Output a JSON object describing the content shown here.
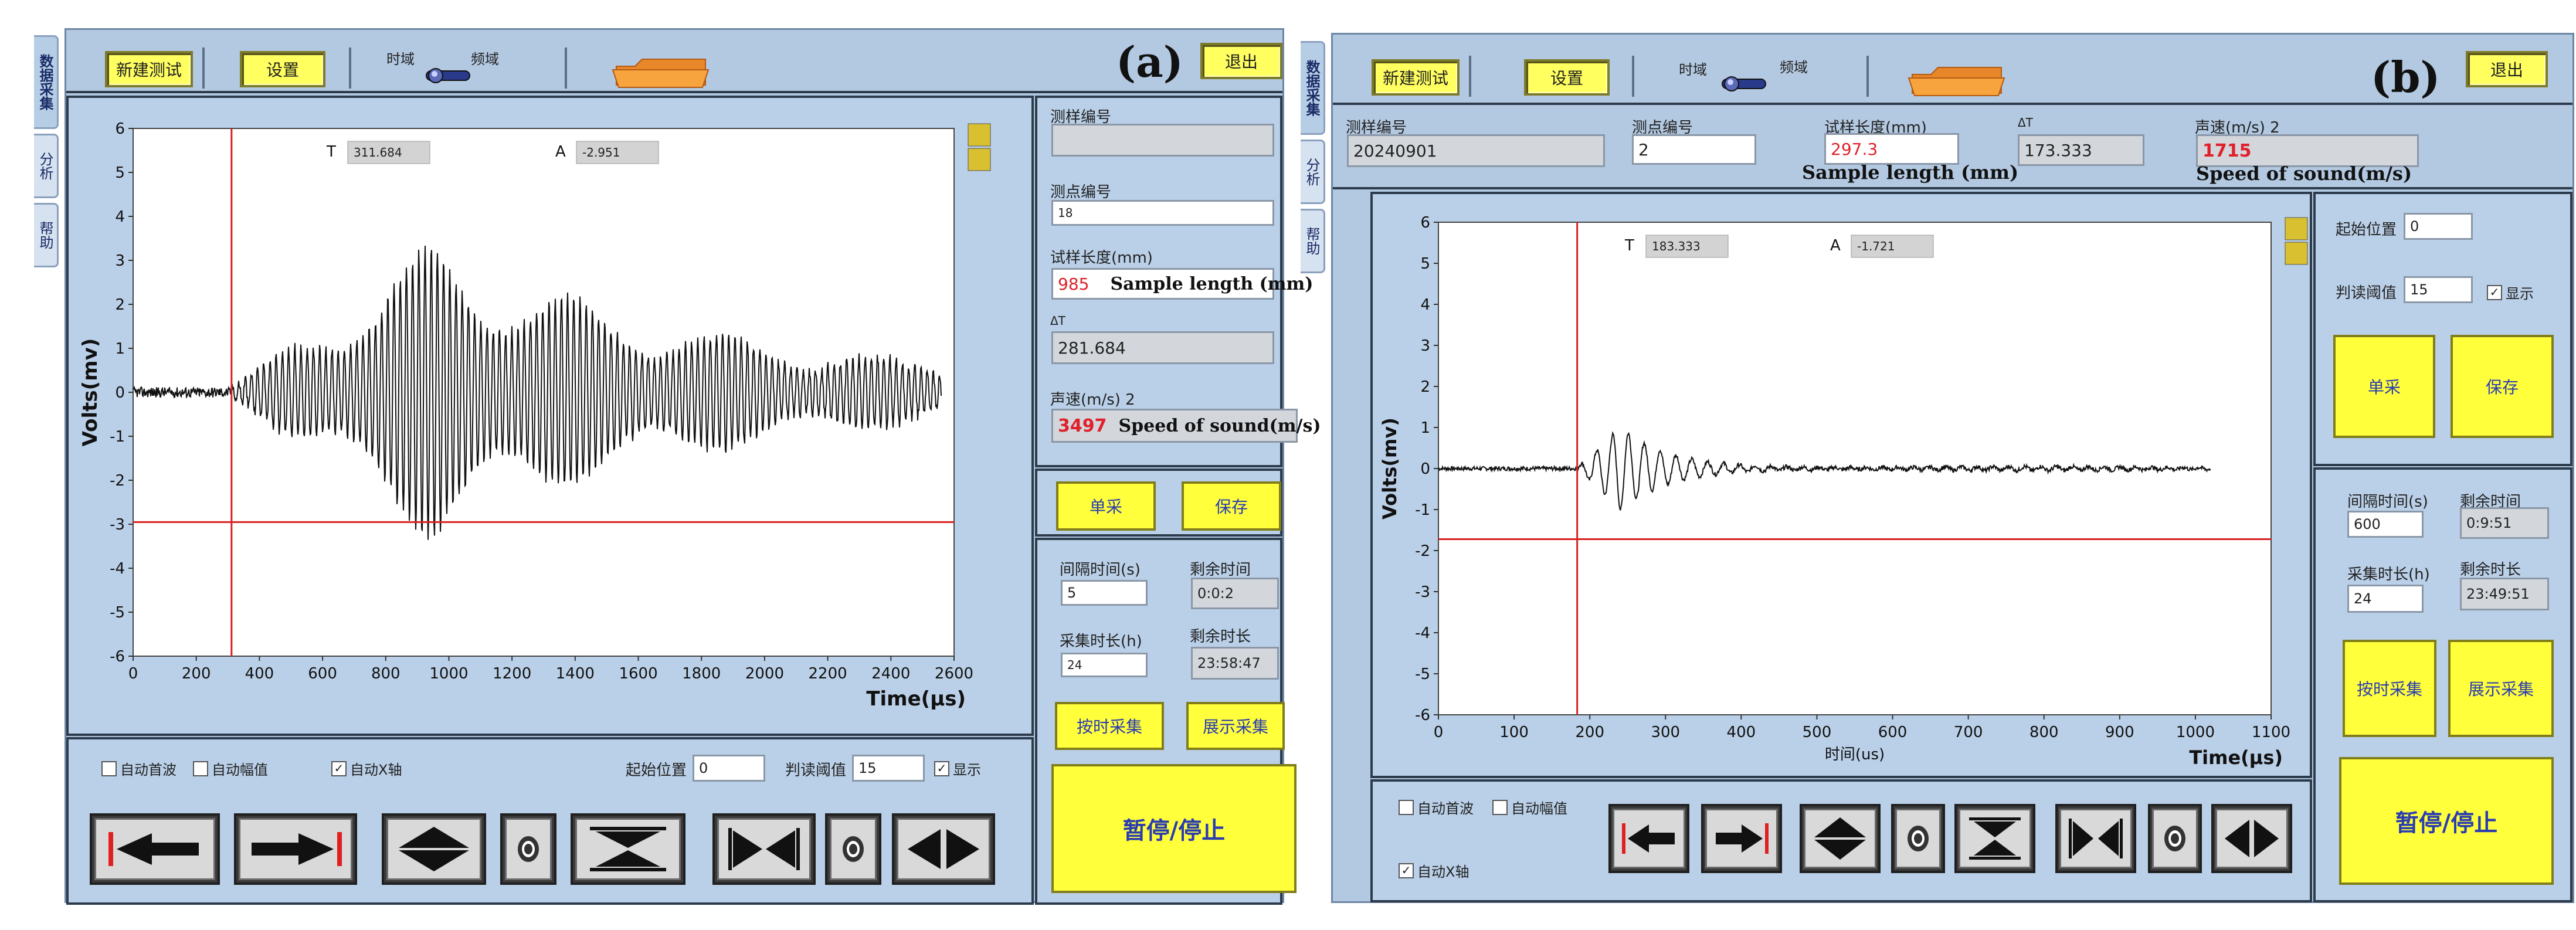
{
  "sidebar": {
    "tabs": [
      "数据采集",
      "分析",
      "帮助"
    ]
  },
  "toolbar": {
    "new_test": "新建测试",
    "settings": "设置",
    "time_domain": "时域",
    "freq_domain": "频域",
    "exit": "退出"
  },
  "fields": {
    "sample_no": "测样编号",
    "point_no": "测点编号",
    "sample_length": "试样长度(mm)",
    "delta_t": "ΔT",
    "sound_speed": "声速(m/s) 2",
    "sample_length_en": "Sample length (mm)",
    "speed_en": "Speed of sound(m/s)"
  },
  "buttons": {
    "single": "单采",
    "save": "保存",
    "timed": "按时采集",
    "show": "展示采集",
    "pause": "暂停/停止"
  },
  "timing": {
    "interval": "间隔时间(s)",
    "remaining": "剩余时间",
    "duration": "采集时长(h)",
    "remaining_duration": "剩余时长"
  },
  "options": {
    "auto_first_wave": "自动首波",
    "auto_amplitude": "自动幅值",
    "auto_x": "自动X轴",
    "start_pos": "起始位置",
    "threshold": "判读阈值",
    "show": "显示"
  },
  "panel_a": {
    "letter": "(a)",
    "sample_no": "",
    "point_no": "18",
    "length": "985",
    "delta_t": "281.684",
    "speed": "3497",
    "interval": "5",
    "remaining": "0:0:2",
    "duration": "24",
    "remaining_duration": "23:58:47",
    "start_pos": "0",
    "threshold": "15",
    "cursor_T": "311.684",
    "cursor_A": "-2.951"
  },
  "panel_b": {
    "letter": "(b)",
    "sample_no": "20240901",
    "point_no": "2",
    "length": "297.3",
    "delta_t": "173.333",
    "speed": "1715",
    "interval": "600",
    "remaining": "0:9:51",
    "duration": "24",
    "remaining_duration": "23:49:51",
    "start_pos": "0",
    "threshold": "15",
    "cursor_T": "183.333",
    "cursor_A": "-1.721"
  },
  "chart_data": [
    {
      "type": "line",
      "title": "",
      "xlabel": "Time(μs)",
      "ylabel": "Volts(mv)",
      "xlim": [
        0,
        2600
      ],
      "ylim": [
        -6,
        6
      ],
      "xticks": [
        0,
        200,
        400,
        600,
        800,
        1000,
        1200,
        1400,
        1600,
        1800,
        2000,
        2200,
        2400,
        2600
      ],
      "yticks": [
        6,
        5,
        4,
        3,
        2,
        1,
        0,
        -1,
        -2,
        -3,
        -4,
        -5,
        -6
      ],
      "cursor": {
        "x": 311.684,
        "y": -2.951
      },
      "signal": {
        "end": 2560,
        "onset": 311,
        "peak_time": 950,
        "peak_amp": 3.3,
        "noise": 0.12
      }
    },
    {
      "type": "line",
      "title": "",
      "xlabel": "时间(us)",
      "xlabel_right": "Time(μs)",
      "ylabel": "Volts(mv)",
      "xlim": [
        0,
        1100
      ],
      "ylim": [
        -6,
        6
      ],
      "xticks": [
        0,
        100,
        200,
        300,
        400,
        500,
        600,
        700,
        800,
        900,
        1000,
        1100
      ],
      "yticks": [
        6,
        5,
        4,
        3,
        2,
        1,
        0,
        -1,
        -2,
        -3,
        -4,
        -5,
        -6
      ],
      "cursor": {
        "x": 183.333,
        "y": -1.721
      },
      "signal": {
        "end": 1020,
        "onset": 183,
        "peak_time": 240,
        "peak_amp": 1.05,
        "noise": 0.05
      }
    }
  ]
}
